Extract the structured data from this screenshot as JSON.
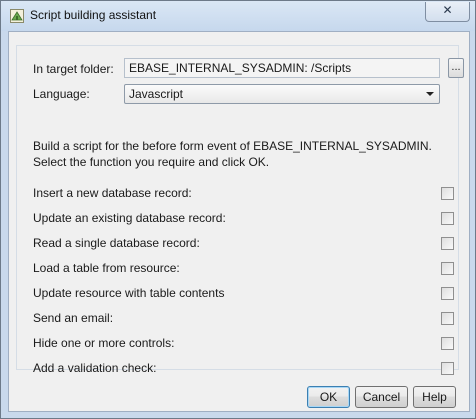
{
  "window": {
    "title": "Script building assistant",
    "close_glyph": "✕"
  },
  "form": {
    "folder_label": "In target folder:",
    "folder_value": "EBASE_INTERNAL_SYSADMIN: /Scripts",
    "browse_label": "...",
    "language_label": "Language:",
    "language_value": "Javascript"
  },
  "description": {
    "line1": "Build a script for the before form event of EBASE_INTERNAL_SYSADMIN.",
    "line2": "Select the function you require and click OK."
  },
  "options": [
    {
      "label": "Insert a new database record:",
      "checked": false
    },
    {
      "label": "Update an existing database record:",
      "checked": false
    },
    {
      "label": "Read a single database record:",
      "checked": false
    },
    {
      "label": "Load a table from resource:",
      "checked": false
    },
    {
      "label": "Update resource with table contents",
      "checked": false
    },
    {
      "label": "Send an email:",
      "checked": false
    },
    {
      "label": "Hide one or more controls:",
      "checked": false
    },
    {
      "label": "Add a validation check:",
      "checked": false
    }
  ],
  "buttons": {
    "ok": "OK",
    "cancel": "Cancel",
    "help": "Help"
  },
  "colors": {
    "frame": "#c9d9ec",
    "client": "#f0f0f0"
  }
}
